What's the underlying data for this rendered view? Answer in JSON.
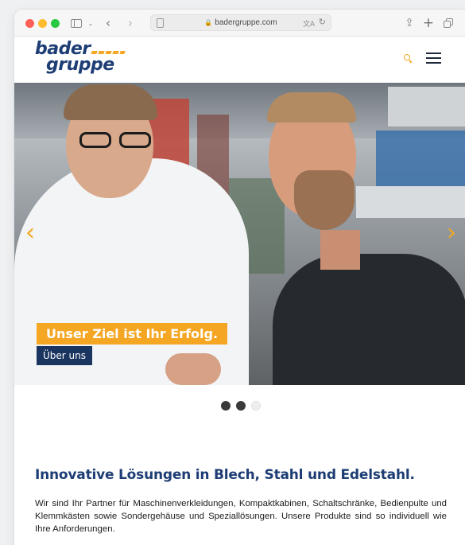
{
  "browser": {
    "url": "badergruppe.com",
    "lock_icon": "lock-icon",
    "back_glyph": "‹",
    "forward_glyph": "›",
    "share_glyph": "⇪",
    "newtab_glyph": "+",
    "translate_glyph": "文A",
    "reload_glyph": "↻",
    "chevron_glyph": "⌄"
  },
  "site": {
    "logo_line1": "bader",
    "logo_line2": "gruppe",
    "brand_colors": {
      "navy": "#1d3d74",
      "orange": "#f5a623"
    }
  },
  "hero": {
    "prev_glyph": "‹",
    "next_glyph": "›",
    "caption": "Unser Ziel ist Ihr Erfolg.",
    "button_label": "Über uns",
    "slides_total": 3,
    "active_slide": 2
  },
  "content": {
    "heading": "Innovative Lösungen in Blech, Stahl und Edelstahl.",
    "paragraph": "Wir sind Ihr Partner für Maschinenverkleidungen, Kompaktkabinen, Schaltschränke, Bedienpulte und Klemmkästen sowie Sondergehäuse und Speziallösungen. Unsere Produkte sind so individuell wie Ihre Anforderungen."
  }
}
